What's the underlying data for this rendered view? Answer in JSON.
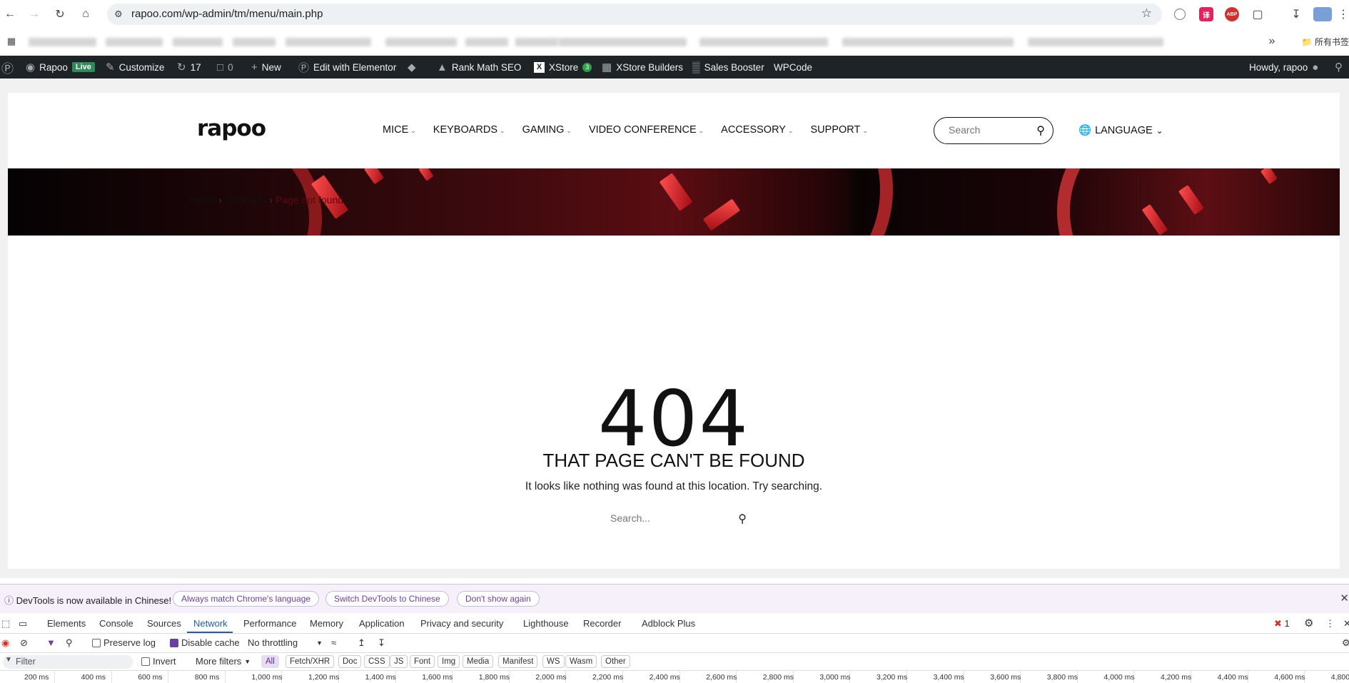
{
  "browser": {
    "url": "rapoo.com/wp-admin/tm/menu/main.php",
    "bookmarks_folder_label": "所有书签"
  },
  "wp_admin_bar": {
    "site_name": "Rapoo",
    "live_badge": "Live",
    "customize": "Customize",
    "updates_count": "17",
    "comments_count": "0",
    "new": "New",
    "elementor": "Edit with Elementor",
    "rank_math": "Rank Math SEO",
    "xstore": "XStore",
    "xstore_badge": "3",
    "xstore_builders": "XStore Builders",
    "sales_booster": "Sales Booster",
    "wpcode": "WPCode",
    "howdy": "Howdy, rapoo"
  },
  "site": {
    "logo": "rapoo",
    "menu": [
      {
        "label": "MICE"
      },
      {
        "label": "KEYBOARDS"
      },
      {
        "label": "GAMING"
      },
      {
        "label": "VIDEO CONFERENCE"
      },
      {
        "label": "ACCESSORY"
      },
      {
        "label": "SUPPORT"
      }
    ],
    "search_placeholder": "Search",
    "language_label": "LANGUAGE",
    "breadcrumb": {
      "home": "Home",
      "error": "Error 404",
      "current": "Page not found"
    },
    "error": {
      "code": "404",
      "title": "THAT PAGE CAN'T BE FOUND",
      "message": "It looks like nothing was found at this location. Try searching.",
      "search_placeholder": "Search..."
    }
  },
  "devtools": {
    "info_text": "DevTools is now available in Chinese!",
    "pill_match": "Always match Chrome's language",
    "pill_switch": "Switch DevTools to Chinese",
    "pill_dismiss": "Don't show again",
    "tabs": [
      "Elements",
      "Console",
      "Sources",
      "Network",
      "Performance",
      "Memory",
      "Application",
      "Privacy and security",
      "Lighthouse",
      "Recorder",
      "Adblock Plus"
    ],
    "active_tab": "Network",
    "error_count": "1",
    "preserve_log": "Preserve log",
    "disable_cache": "Disable cache",
    "throttling": "No throttling",
    "filter_placeholder": "Filter",
    "invert": "Invert",
    "more_filters": "More filters",
    "types": [
      "All",
      "Fetch/XHR",
      "Doc",
      "CSS",
      "JS",
      "Font",
      "Img",
      "Media",
      "Manifest",
      "WS",
      "Wasm",
      "Other"
    ],
    "timeline_ticks": [
      "200 ms",
      "400 ms",
      "600 ms",
      "800 ms",
      "1,000 ms",
      "1,200 ms",
      "1,400 ms",
      "1,600 ms",
      "1,800 ms",
      "2,000 ms",
      "2,200 ms",
      "2,400 ms",
      "2,600 ms",
      "2,800 ms",
      "3,000 ms",
      "3,200 ms",
      "3,400 ms",
      "3,600 ms",
      "3,800 ms",
      "4,000 ms",
      "4,200 ms",
      "4,400 ms",
      "4,600 ms",
      "4,800"
    ]
  }
}
